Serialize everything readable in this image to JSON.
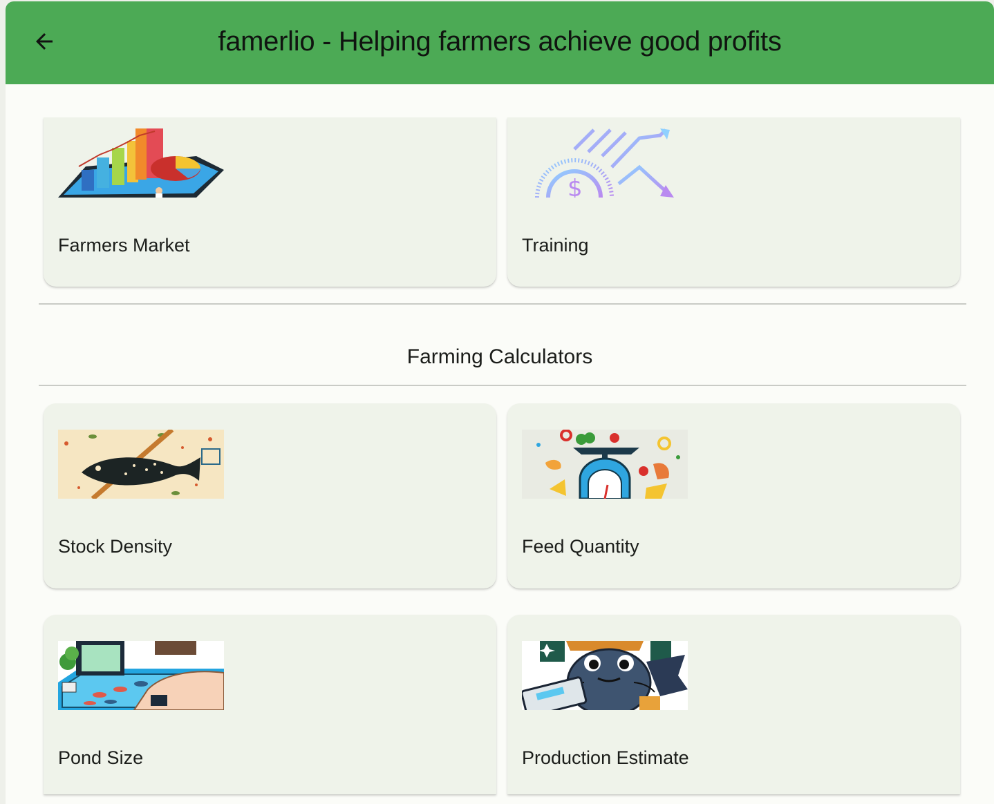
{
  "app_bar": {
    "title": "famerlio - Helping farmers achieve good profits",
    "back_icon": "arrow-back-icon",
    "color": "#4caa55"
  },
  "top_cards": [
    {
      "label": "Farmers Market",
      "icon": "market-chart-illustration"
    },
    {
      "label": "Training",
      "icon": "finance-training-illustration"
    }
  ],
  "section": {
    "title": "Farming Calculators"
  },
  "calculator_cards": [
    {
      "label": "Stock Density",
      "icon": "fish-density-illustration"
    },
    {
      "label": "Feed Quantity",
      "icon": "feed-scale-illustration"
    },
    {
      "label": "Pond Size",
      "icon": "pond-size-illustration"
    },
    {
      "label": "Production Estimate",
      "icon": "catfish-estimate-illustration"
    }
  ]
}
